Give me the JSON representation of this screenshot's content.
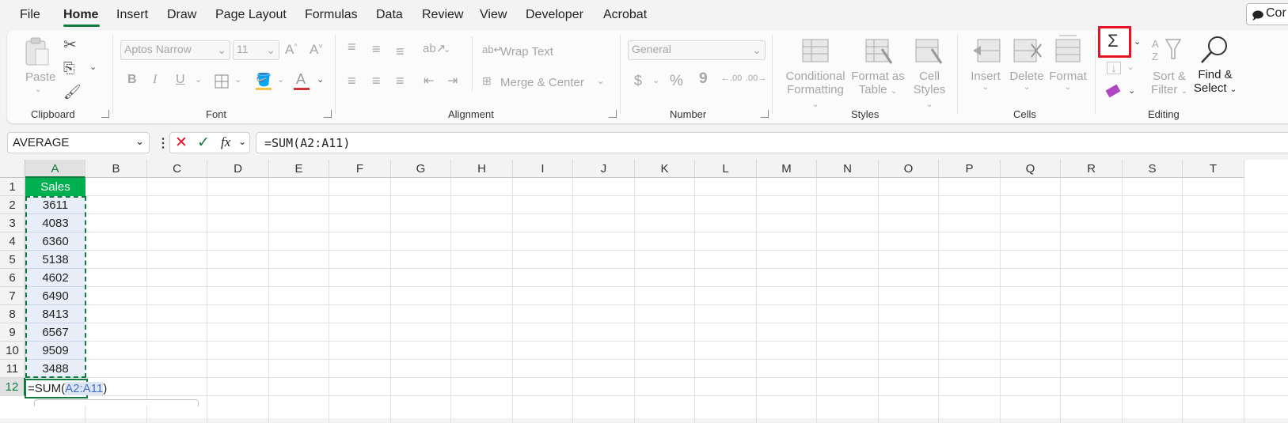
{
  "menu": {
    "tabs": [
      "File",
      "Home",
      "Insert",
      "Draw",
      "Page Layout",
      "Formulas",
      "Data",
      "Review",
      "View",
      "Developer",
      "Acrobat"
    ],
    "active": "Home",
    "comments_label": "Cor"
  },
  "ribbon": {
    "clipboard": {
      "paste": "Paste",
      "label": "Clipboard"
    },
    "font": {
      "name": "Aptos Narrow",
      "size": "11",
      "label": "Font",
      "bold": "B",
      "italic": "I",
      "underline": "U"
    },
    "alignment": {
      "wrap_text": "Wrap Text",
      "merge_center": "Merge & Center",
      "label": "Alignment"
    },
    "number": {
      "format": "General",
      "currency": "$",
      "percent": "%",
      "comma": "9",
      "inc_decimal": ".00",
      "dec_decimal": ".00",
      "label": "Number"
    },
    "styles": {
      "conditional_1": "Conditional",
      "conditional_2": "Formatting",
      "format_table_1": "Format as",
      "format_table_2": "Table",
      "cell_styles_1": "Cell",
      "cell_styles_2": "Styles",
      "label": "Styles"
    },
    "cells": {
      "insert": "Insert",
      "delete": "Delete",
      "format": "Format",
      "label": "Cells"
    },
    "editing": {
      "autosum": "Σ",
      "sort_filter_1": "Sort &",
      "sort_filter_2": "Filter",
      "find_select_1": "Find &",
      "find_select_2": "Select",
      "label": "Editing"
    }
  },
  "formula_bar": {
    "name_box": "AVERAGE",
    "fx": "fx",
    "formula": "=SUM(A2:A11)"
  },
  "sheet": {
    "columns": [
      "A",
      "B",
      "C",
      "D",
      "E",
      "F",
      "G",
      "H",
      "I",
      "J",
      "K",
      "L",
      "M",
      "N",
      "O",
      "P",
      "Q",
      "R",
      "S",
      "T"
    ],
    "rows": [
      "1",
      "2",
      "3",
      "4",
      "5",
      "6",
      "7",
      "8",
      "9",
      "10",
      "11",
      "12"
    ],
    "header_cell": "Sales",
    "values": [
      "3611",
      "4083",
      "6360",
      "5138",
      "4602",
      "6490",
      "8413",
      "6567",
      "9509",
      "3488"
    ],
    "edit_cell_prefix": "=SUM(",
    "edit_cell_range": "A2:A11",
    "edit_cell_suffix": ")"
  },
  "colors": {
    "accent_green": "#107c41",
    "header_fill": "#00b050",
    "highlight_red": "#e81123",
    "range_blue": "#4472c4"
  }
}
